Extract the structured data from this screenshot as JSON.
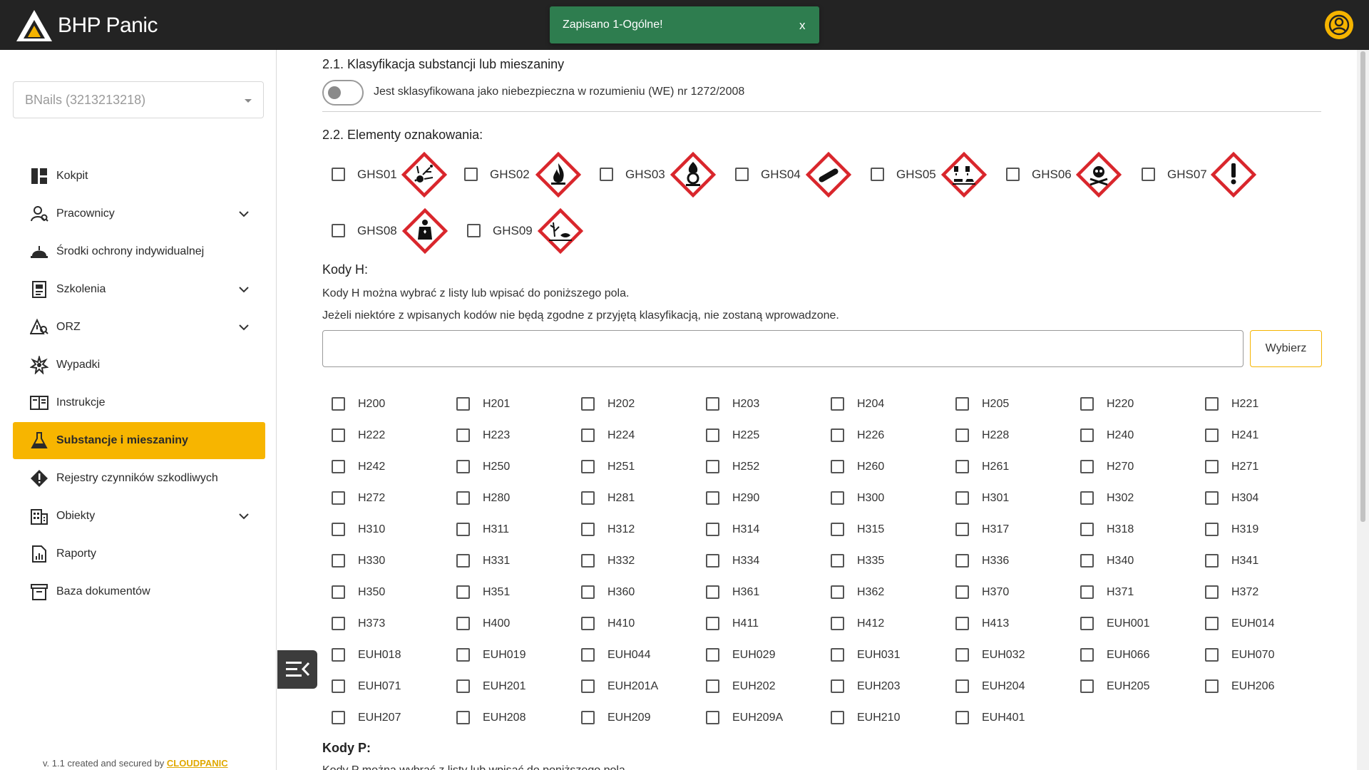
{
  "app": {
    "brand": "BHP Panic"
  },
  "toast": {
    "message": "Zapisano 1-Ogólne!",
    "close": "x",
    "color": "#2e7d4f"
  },
  "accent": "#f7b500",
  "sidebar": {
    "company": "BNails (3213213218)",
    "items": [
      {
        "label": "Kokpit",
        "icon": "dashboard-icon",
        "expandable": false,
        "active": false
      },
      {
        "label": "Pracownicy",
        "icon": "users-icon",
        "expandable": true,
        "active": false
      },
      {
        "label": "Środki ochrony indywidualnej",
        "icon": "helmet-icon",
        "expandable": false,
        "active": false
      },
      {
        "label": "Szkolenia",
        "icon": "training-icon",
        "expandable": true,
        "active": false
      },
      {
        "label": "ORZ",
        "icon": "risk-icon",
        "expandable": true,
        "active": false
      },
      {
        "label": "Wypadki",
        "icon": "accident-icon",
        "expandable": false,
        "active": false
      },
      {
        "label": "Instrukcje",
        "icon": "book-icon",
        "expandable": false,
        "active": false
      },
      {
        "label": "Substancje i mieszaniny",
        "icon": "flask-icon",
        "expandable": false,
        "active": true
      },
      {
        "label": "Rejestry czynników szkodliwych",
        "icon": "warning-icon",
        "expandable": false,
        "active": false
      },
      {
        "label": "Obiekty",
        "icon": "building-icon",
        "expandable": true,
        "active": false
      },
      {
        "label": "Raporty",
        "icon": "report-icon",
        "expandable": false,
        "active": false
      },
      {
        "label": "Baza dokumentów",
        "icon": "archive-icon",
        "expandable": false,
        "active": false
      }
    ],
    "footer_prefix": "v. 1.1 created and secured by ",
    "footer_brand": "CLOUDPANIC"
  },
  "classification": {
    "title": "2.1. Klasyfikacja substancji lub mieszaniny",
    "toggle_label": "Jest sklasyfikowana jako niebezpieczna w rozumieniu (WE) nr 1272/2008",
    "toggle_on": false
  },
  "labeling": {
    "title": "2.2. Elementy oznakowania:",
    "ghs": [
      {
        "code": "GHS01",
        "icon": "exploding-bomb-icon"
      },
      {
        "code": "GHS02",
        "icon": "flame-icon"
      },
      {
        "code": "GHS03",
        "icon": "flame-over-circle-icon"
      },
      {
        "code": "GHS04",
        "icon": "gas-cylinder-icon"
      },
      {
        "code": "GHS05",
        "icon": "corrosion-icon"
      },
      {
        "code": "GHS06",
        "icon": "skull-crossbones-icon"
      },
      {
        "code": "GHS07",
        "icon": "exclamation-icon"
      },
      {
        "code": "GHS08",
        "icon": "health-hazard-icon"
      },
      {
        "code": "GHS09",
        "icon": "environment-icon"
      }
    ]
  },
  "hcodes": {
    "title": "Kody H:",
    "note1": "Kody H można wybrać z listy lub wpisać do poniższego pola.",
    "note2": "Jeżeli niektóre z wpisanych kodów nie będą zgodne z przyjętą klasyfikacją, nie zostaną wprowadzone.",
    "input_value": "",
    "button": "Wybierz",
    "codes": [
      "H200",
      "H201",
      "H202",
      "H203",
      "H204",
      "H205",
      "H220",
      "H221",
      "H222",
      "H223",
      "H224",
      "H225",
      "H226",
      "H228",
      "H240",
      "H241",
      "H242",
      "H250",
      "H251",
      "H252",
      "H260",
      "H261",
      "H270",
      "H271",
      "H272",
      "H280",
      "H281",
      "H290",
      "H300",
      "H301",
      "H302",
      "H304",
      "H310",
      "H311",
      "H312",
      "H314",
      "H315",
      "H317",
      "H318",
      "H319",
      "H330",
      "H331",
      "H332",
      "H334",
      "H335",
      "H336",
      "H340",
      "H341",
      "H350",
      "H351",
      "H360",
      "H361",
      "H362",
      "H370",
      "H371",
      "H372",
      "H373",
      "H400",
      "H410",
      "H411",
      "H412",
      "H413",
      "EUH001",
      "EUH014",
      "EUH018",
      "EUH019",
      "EUH044",
      "EUH029",
      "EUH031",
      "EUH032",
      "EUH066",
      "EUH070",
      "EUH071",
      "EUH201",
      "EUH201A",
      "EUH202",
      "EUH203",
      "EUH204",
      "EUH205",
      "EUH206",
      "EUH207",
      "EUH208",
      "EUH209",
      "EUH209A",
      "EUH210",
      "EUH401"
    ]
  },
  "pcodes": {
    "title": "Kody P:",
    "note1": "Kody P można wybrać z listy lub wpisać do poniższego pola."
  }
}
